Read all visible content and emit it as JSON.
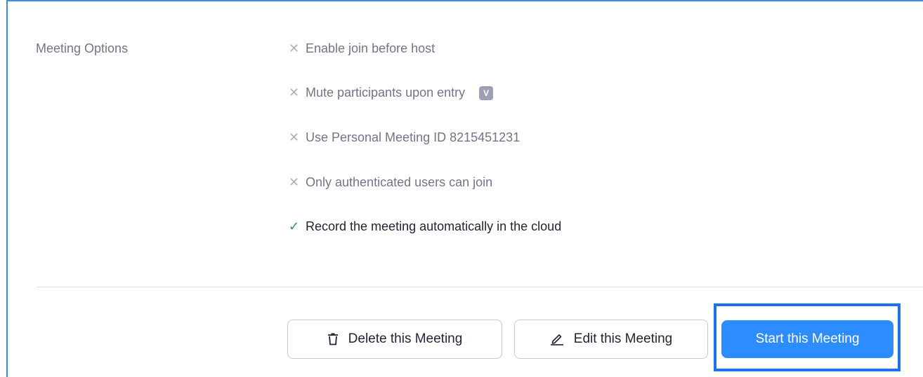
{
  "meeting_options": {
    "label": "Meeting Options",
    "items": [
      {
        "text": "Enable join before host",
        "enabled": false,
        "icon": "x-icon"
      },
      {
        "text": "Mute participants upon entry",
        "enabled": false,
        "icon": "x-icon",
        "badge_icon": "info-badge-icon",
        "badge_text": "V"
      },
      {
        "text": "Use Personal Meeting ID 8215451231",
        "enabled": false,
        "icon": "x-icon"
      },
      {
        "text": "Only authenticated users can join",
        "enabled": false,
        "icon": "x-icon"
      },
      {
        "text": "Record the meeting automatically in the cloud",
        "enabled": true,
        "icon": "check-icon"
      }
    ]
  },
  "actions": {
    "delete_label": "Delete this Meeting",
    "edit_label": "Edit this Meeting",
    "start_label": "Start this Meeting"
  },
  "colors": {
    "primary": "#2d8cff",
    "focus_ring": "#1a73e8",
    "check": "#24a04a",
    "muted_text": "#747487"
  }
}
